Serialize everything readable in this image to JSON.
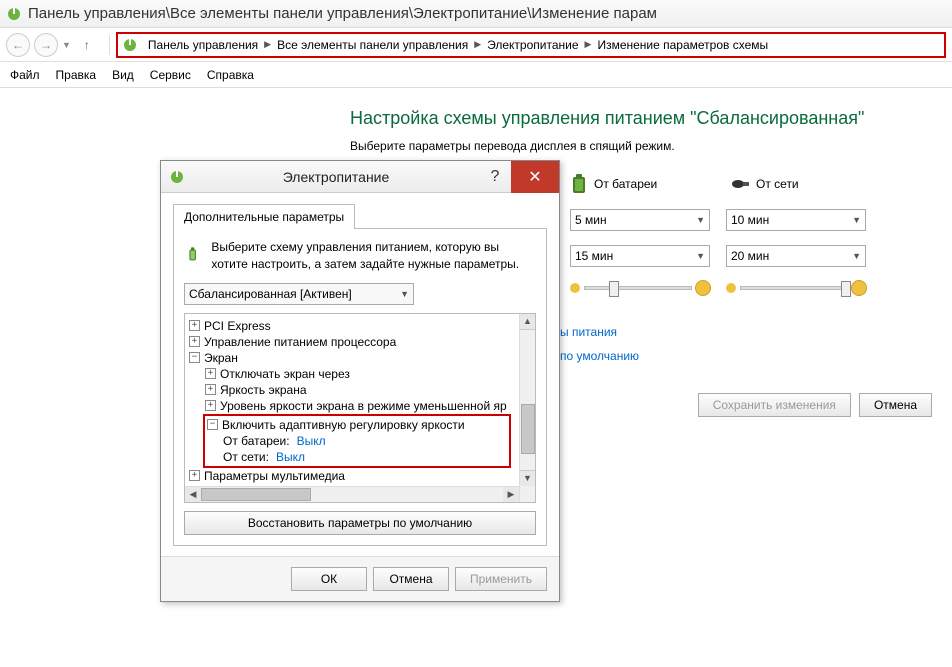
{
  "window": {
    "title": "Панель управления\\Все элементы панели управления\\Электропитание\\Изменение парам"
  },
  "breadcrumb": {
    "items": [
      "Панель управления",
      "Все элементы панели управления",
      "Электропитание",
      "Изменение параметров схемы"
    ]
  },
  "menu": {
    "items": [
      "Файл",
      "Правка",
      "Вид",
      "Сервис",
      "Справка"
    ]
  },
  "page": {
    "title": "Настройка схемы управления питанием \"Сбалансированная\"",
    "subtitle": "Выберите параметры перевода дисплея в спящий режим.",
    "col_battery": "От батареи",
    "col_plugged": "От сети",
    "dd_values": {
      "row1_battery": "5 мин",
      "row1_plugged": "10 мин",
      "row2_battery": "15 мин",
      "row2_plugged": "20 мин"
    },
    "link_power": "ы питания",
    "link_defaults": "по умолчанию",
    "btn_save": "Сохранить изменения",
    "btn_cancel": "Отмена"
  },
  "dialog": {
    "title": "Электропитание",
    "tab": "Дополнительные параметры",
    "info": "Выберите схему управления питанием, которую вы хотите настроить, а затем задайте нужные параметры.",
    "scheme": "Сбалансированная [Активен]",
    "tree": {
      "pci": "PCI Express",
      "cpu": "Управление питанием процессора",
      "screen": "Экран",
      "screen_off": "Отключать экран через",
      "brightness": "Яркость экрана",
      "dim_brightness": "Уровень яркости экрана в режиме уменьшенной яр",
      "adaptive": "Включить адаптивную регулировку яркости",
      "adaptive_battery_label": "От батареи:",
      "adaptive_battery_value": "Выкл",
      "adaptive_plugged_label": "От сети:",
      "adaptive_plugged_value": "Выкл",
      "multimedia": "Параметры мультимедиа"
    },
    "restore": "Восстановить параметры по умолчанию",
    "ok": "ОК",
    "cancel": "Отмена",
    "apply": "Применить"
  }
}
